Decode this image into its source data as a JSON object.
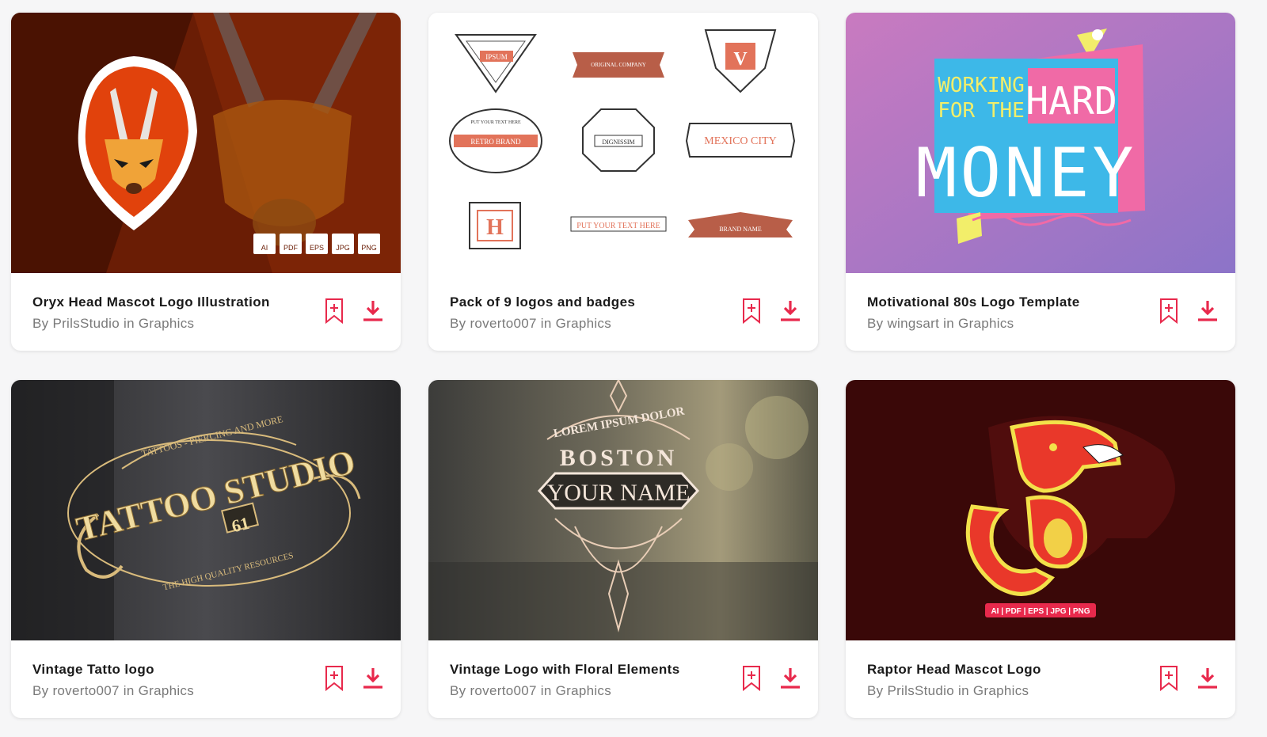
{
  "accent_color": "#e8294c",
  "cards": [
    {
      "title": "Oryx Head Mascot Logo Illustration",
      "byline": "By PrilsStudio in Graphics",
      "thumb_icon": "oryx-mascot",
      "formats": [
        "AI",
        "PDF",
        "EPS",
        "JPG",
        "PNG"
      ]
    },
    {
      "title": "Pack of 9 logos and badges",
      "byline": "By roverto007 in Graphics",
      "thumb_icon": "vintage-badges",
      "badge_texts": [
        "IPSUM",
        "ORIGINAL COMPANY",
        "V",
        "RETRO BRAND",
        "PUT YOUR TEXT HERE",
        "DIGNISSIM",
        "MEXICO CITY",
        "H",
        "PUT YOUR TEXT HERE",
        "BRAND NAME"
      ]
    },
    {
      "title": "Motivational 80s Logo Template",
      "byline": "By wingsart in Graphics",
      "thumb_icon": "retro-80s",
      "art_text": [
        "WORKING",
        "FOR THE",
        "HARD",
        "MONEY"
      ]
    },
    {
      "title": "Vintage Tatto logo",
      "byline": "By roverto007 in Graphics",
      "thumb_icon": "tattoo-studio",
      "art_text": [
        "TATTOOS - PIERCING AND MORE",
        "TATTOO STUDIO",
        "61",
        "THE HIGH QUALITY RESOURCES"
      ]
    },
    {
      "title": "Vintage Logo with Floral Elements",
      "byline": "By roverto007 in Graphics",
      "thumb_icon": "boston-floral",
      "art_text": [
        "LOREM IPSUM DOLOR",
        "BOSTON",
        "YOUR NAME"
      ]
    },
    {
      "title": "Raptor Head Mascot Logo",
      "byline": "By PrilsStudio in Graphics",
      "thumb_icon": "raptor-mascot",
      "formats_line": "AI | PDF | EPS | JPG | PNG"
    }
  ]
}
